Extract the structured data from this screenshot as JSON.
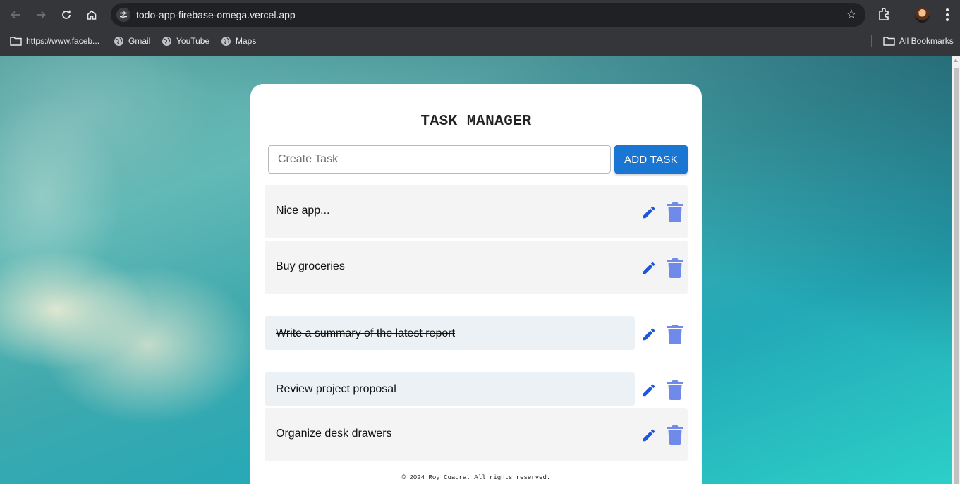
{
  "browser": {
    "url": "todo-app-firebase-omega.vercel.app",
    "bookmarks": [
      {
        "label": "https://www.faceb...",
        "icon": "folder-icon"
      },
      {
        "label": "Gmail",
        "icon": "globe-icon"
      },
      {
        "label": "YouTube",
        "icon": "globe-icon"
      },
      {
        "label": "Maps",
        "icon": "globe-icon"
      }
    ],
    "all_bookmarks_label": "All Bookmarks"
  },
  "app": {
    "title": "TASK MANAGER",
    "input_placeholder": "Create Task",
    "input_value": "",
    "add_button_label": "ADD TASK",
    "tasks": [
      {
        "text": "Nice app...",
        "completed": false
      },
      {
        "text": "Buy groceries",
        "completed": false
      },
      {
        "text": "Write a summary of the latest report",
        "completed": true
      },
      {
        "text": "Review project proposal",
        "completed": true
      },
      {
        "text": "Organize desk drawers",
        "completed": false
      }
    ],
    "footer": "© 2024 Roy Cuadra. All rights reserved."
  },
  "colors": {
    "accent": "#1976d2",
    "edit_icon": "#1e56d8",
    "delete_icon": "#6f8ae8"
  }
}
